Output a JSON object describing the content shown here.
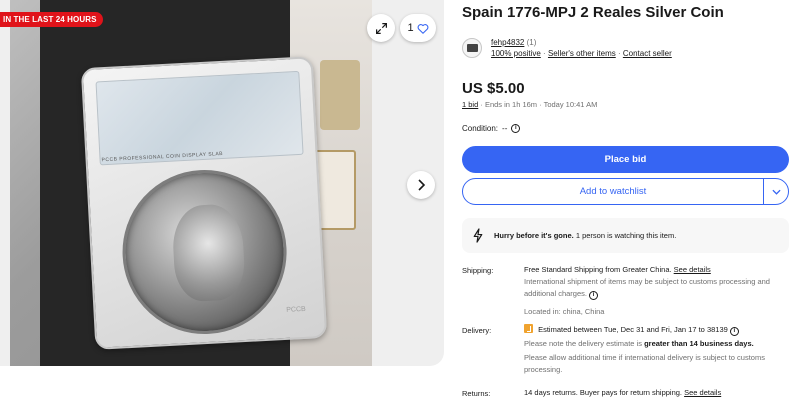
{
  "gallery": {
    "badge": "IN THE LAST 24 HOURS",
    "watchers_count": "1",
    "slab_label_text": "PCCB PROFESSIONAL COIN DISPLAY SLAB",
    "slab_brand": "PCCB"
  },
  "listing": {
    "title": "Spain 1776-MPJ 2 Reales Silver Coin",
    "seller_name": "fehp4832",
    "seller_rating": "(1)",
    "positive": "100% positive",
    "other_items": "Seller's other items",
    "contact": "Contact seller",
    "price": "US $5.00",
    "bids_link": "1 bid",
    "ends_text": "· Ends in 1h 16m · Today 10:41 AM",
    "condition_label": "Condition:",
    "condition_value": "--",
    "place_bid": "Place bid",
    "add_watchlist": "Add to watchlist",
    "hurry_bold": "Hurry before it's gone.",
    "hurry_rest": "1 person is watching this item."
  },
  "shipping": {
    "label": "Shipping:",
    "main": "Free Standard Shipping from Greater China.",
    "see_details": "See details",
    "intl_note": "International shipment of items may be subject to customs processing and additional charges.",
    "located": "Located in: china, China"
  },
  "delivery": {
    "label": "Delivery:",
    "estimated": "Estimated between Tue, Dec 31 and Fri, Jan 17 to 38139",
    "note_prefix": "Please note the delivery estimate is",
    "note_bold": "greater than 14 business days.",
    "allow_note": "Please allow additional time if international delivery is subject to customs processing."
  },
  "returns": {
    "label": "Returns:",
    "text": "14 days returns. Buyer pays for return shipping.",
    "see_details": "See details"
  },
  "colors": {
    "primary": "#3665f3",
    "badge_red": "#e0131a",
    "text": "#191919",
    "muted": "#707070",
    "clip_orange": "#f0a32f"
  },
  "icons": [
    "expand-icon",
    "heart-icon",
    "chevron-right-icon",
    "info-icon",
    "lightning-icon",
    "chevron-down-icon",
    "shipping-clip-icon"
  ]
}
